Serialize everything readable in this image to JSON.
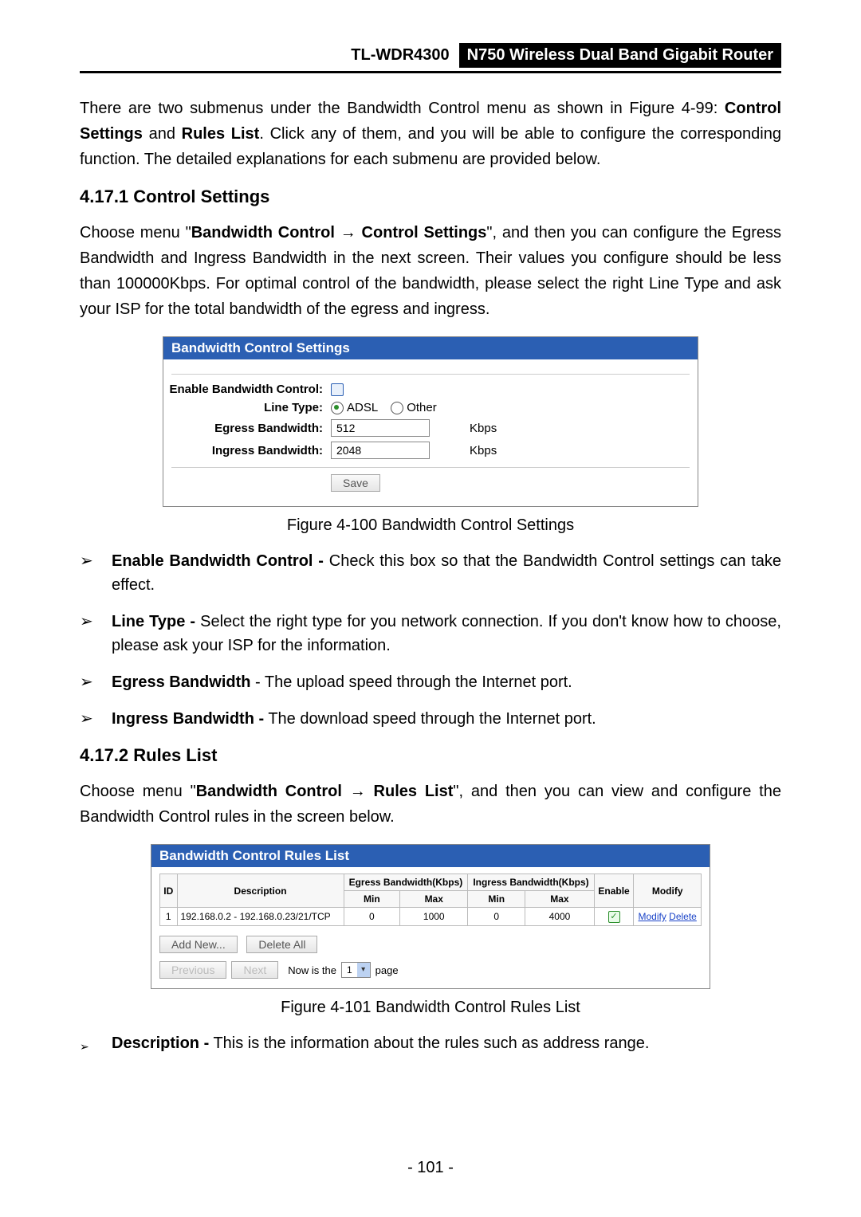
{
  "header": {
    "model": "TL-WDR4300",
    "title": "N750 Wireless Dual Band Gigabit Router"
  },
  "intro": {
    "p1a": "There are two submenus under the Bandwidth Control menu as shown in Figure 4-99: ",
    "p1b": "Control Settings",
    "p1c": " and ",
    "p1d": "Rules List",
    "p1e": ". Click any of them, and you will be able to configure the corresponding function. The detailed explanations for each submenu are provided below."
  },
  "s1": {
    "heading": "4.17.1  Control Settings",
    "p_a": "Choose menu \"",
    "p_b": "Bandwidth Control",
    "p_arrow": " → ",
    "p_c": "Control Settings",
    "p_d": "\", and then you can configure the Egress Bandwidth and Ingress Bandwidth in the next screen. Their values you configure should be less than 100000Kbps. For optimal control of the bandwidth, please select the right Line Type and ask your ISP for the total bandwidth of the egress and ingress."
  },
  "fig100": {
    "title": "Bandwidth Control Settings",
    "enable_label": "Enable Bandwidth Control:",
    "linetype_label": "Line Type:",
    "radio_adsl": "ADSL",
    "radio_other": "Other",
    "egress_label": "Egress Bandwidth:",
    "egress_value": "512",
    "ingress_label": "Ingress Bandwidth:",
    "ingress_value": "2048",
    "unit": "Kbps",
    "save": "Save",
    "caption": "Figure 4-100 Bandwidth Control Settings"
  },
  "bullets1": {
    "b1_a": "Enable Bandwidth Control -",
    "b1_b": " Check this box so that the Bandwidth Control settings can take effect.",
    "b2_a": "Line Type -",
    "b2_b": " Select the right type for you network connection. If you don't know how to choose, please ask your ISP for the information.",
    "b3_a": "Egress Bandwidth",
    "b3_b": " - The upload speed through the Internet port.",
    "b4_a": "Ingress Bandwidth -",
    "b4_b": " The download speed through the Internet port."
  },
  "s2": {
    "heading": "4.17.2  Rules List",
    "p_a": "Choose menu \"",
    "p_b": "Bandwidth Control",
    "p_arrow": " → ",
    "p_c": "Rules List",
    "p_d": "\", and then you can view and configure the Bandwidth Control rules in the screen below."
  },
  "fig101": {
    "title": "Bandwidth Control Rules List",
    "headers": {
      "id": "ID",
      "desc": "Description",
      "egress": "Egress Bandwidth(Kbps)",
      "ingress": "Ingress Bandwidth(Kbps)",
      "min": "Min",
      "max": "Max",
      "enable": "Enable",
      "modify": "Modify"
    },
    "row": {
      "id": "1",
      "desc": "192.168.0.2 - 192.168.0.23/21/TCP",
      "emin": "0",
      "emax": "1000",
      "imin": "0",
      "imax": "4000",
      "modify": "Modify",
      "delete": "Delete"
    },
    "add_new": "Add New...",
    "delete_all": "Delete All",
    "previous": "Previous",
    "next": "Next",
    "now_is_the": "Now is the",
    "page_num": "1",
    "page_word": "page",
    "caption": "Figure 4-101 Bandwidth Control Rules List"
  },
  "bullets2": {
    "b1_a": "Description -",
    "b1_b": " This is the information about the rules such as address range."
  },
  "footer": {
    "pagenum": "- 101 -"
  }
}
